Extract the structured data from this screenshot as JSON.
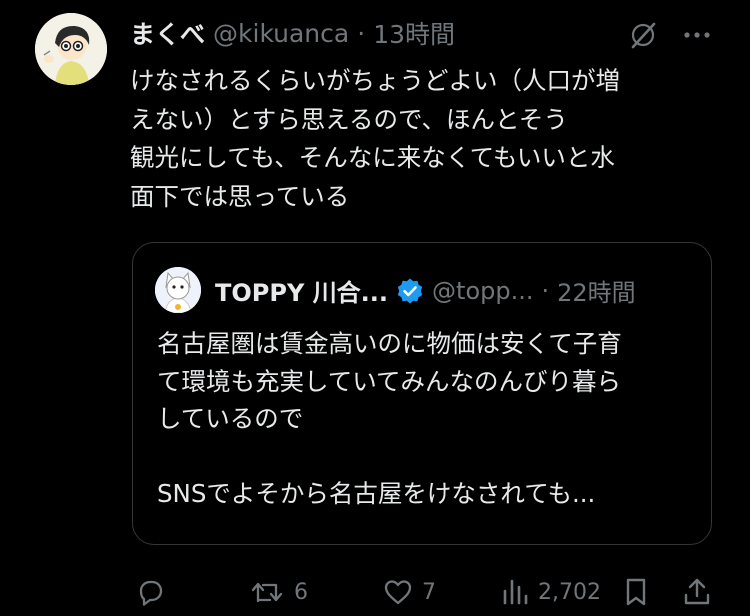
{
  "tweet": {
    "author_name": "まくべ",
    "author_handle": "@kikuanca",
    "separator": "·",
    "time": "13時間",
    "lines": [
      "けなされるくらいがちょうどよい（人口が増",
      "えない）とすら思えるので、ほんとそう",
      "観光にしても、そんなに来なくてもいいと水",
      "面下では思っている"
    ]
  },
  "quote": {
    "author_name": "TOPPY 川合...",
    "author_handle": "@topp...",
    "separator": "·",
    "time": "22時間",
    "lines": [
      "名古屋圏は賃金高いのに物価は安くて子育",
      "て環境も充実していてみんなのんびり暮ら",
      "しているので",
      "",
      "SNSでよそから名古屋をけなされても..."
    ]
  },
  "actions": {
    "reply_count": "",
    "retweet_count": "6",
    "like_count": "7",
    "view_count": "2,702"
  },
  "icons": {
    "grok": "grok-icon",
    "more": "more-icon",
    "verified": "verified-badge-icon",
    "reply": "reply-icon",
    "retweet": "retweet-icon",
    "like": "heart-icon",
    "views": "views-icon",
    "bookmark": "bookmark-icon",
    "share": "share-icon"
  },
  "colors": {
    "background": "#000000",
    "text": "#e7e9ea",
    "muted": "#71767b",
    "border": "#333639",
    "verified": "#1d9bf0"
  }
}
